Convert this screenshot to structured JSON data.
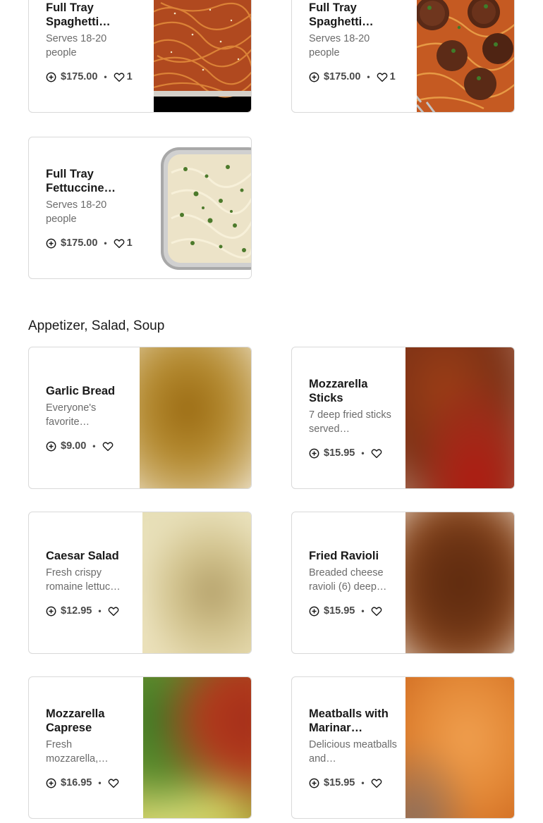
{
  "section_catering_tail": {
    "items": [
      {
        "title": "Full Tray Spaghetti…",
        "desc": "Serves 18-20 people",
        "price": "$175.00",
        "likes": "1"
      },
      {
        "title": "Full Tray Spaghetti…",
        "desc": "Serves 18-20 people",
        "price": "$175.00",
        "likes": "1"
      },
      {
        "title": "Full Tray Fettuccine…",
        "desc": "Serves 18-20 people",
        "price": "$175.00",
        "likes": "1"
      }
    ]
  },
  "section_appetizers": {
    "title": "Appetizer, Salad, Soup",
    "items": [
      {
        "title": "Garlic Bread",
        "desc": "Everyone's favorite…",
        "price": "$9.00"
      },
      {
        "title": "Mozzarella Sticks",
        "desc": "7 deep fried sticks served…",
        "price": "$15.95"
      },
      {
        "title": "Caesar Salad",
        "desc": "Fresh crispy romaine lettuc…",
        "price": "$12.95"
      },
      {
        "title": "Fried Ravioli",
        "desc": "Breaded cheese ravioli (6) deep…",
        "price": "$15.95"
      },
      {
        "title": "Mozzarella Caprese",
        "desc": "Fresh mozzarella,…",
        "price": "$16.95"
      },
      {
        "title": "Meatballs with Marinar…",
        "desc": "Delicious meatballs and…",
        "price": "$15.95"
      }
    ]
  },
  "icons": {
    "add": "add-circle-icon",
    "like": "heart-icon"
  },
  "colors": {
    "text": "#191919",
    "muted": "#6b6b6b",
    "meta": "#494949",
    "border": "#d9d9d9"
  }
}
